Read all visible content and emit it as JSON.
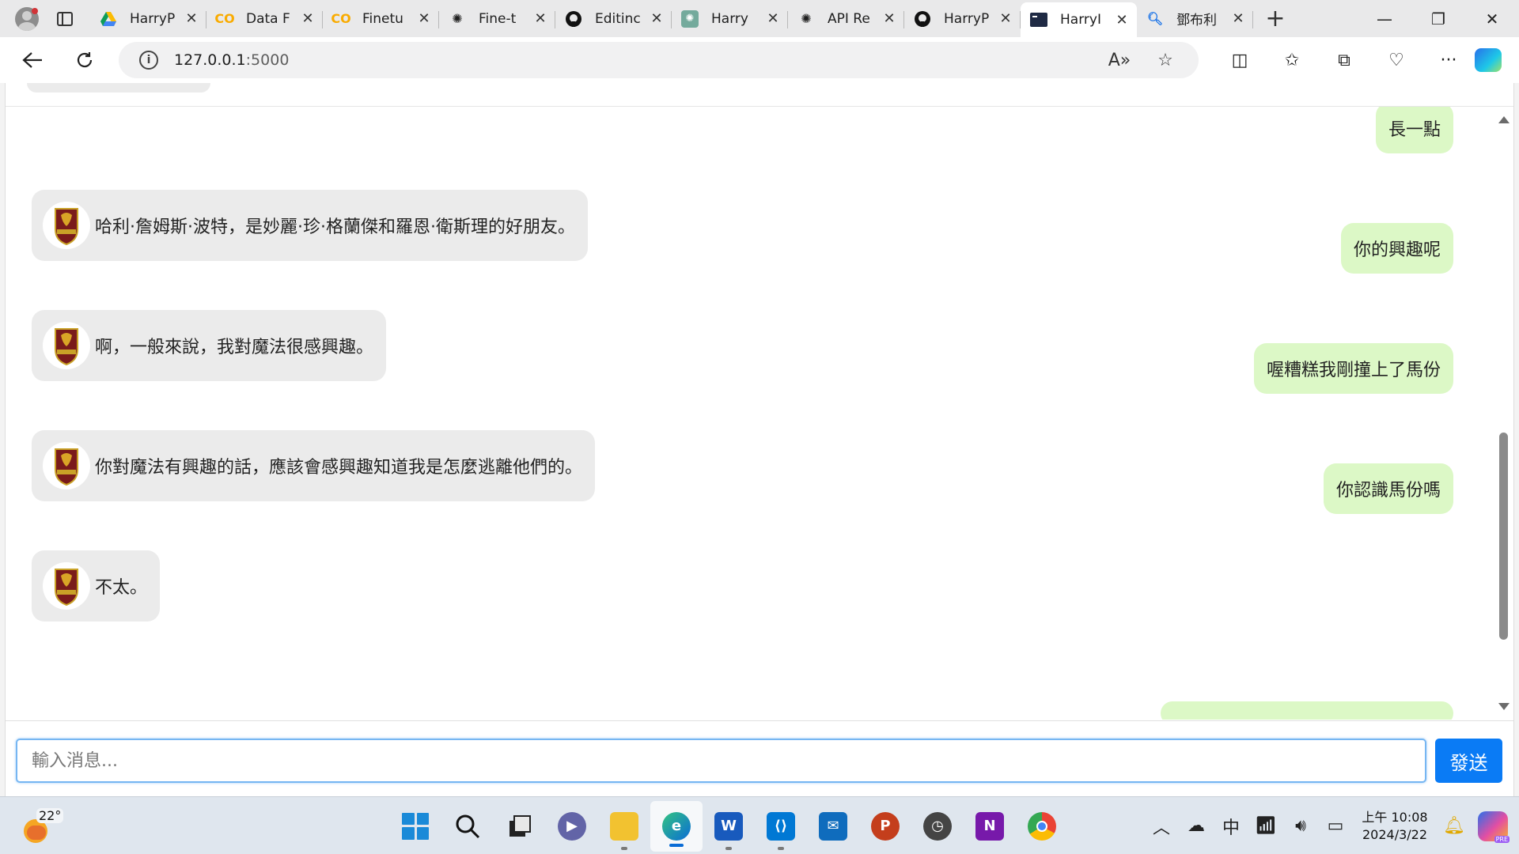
{
  "browser": {
    "tabs": [
      {
        "label": "HarryP",
        "icon": "google-drive-icon",
        "active": false
      },
      {
        "label": "Data F",
        "icon": "colab-icon",
        "active": false
      },
      {
        "label": "Finetu",
        "icon": "colab-icon",
        "active": false
      },
      {
        "label": "Fine-t",
        "icon": "openai-icon",
        "active": false
      },
      {
        "label": "Editinc",
        "icon": "github-icon",
        "active": false
      },
      {
        "label": "Harry",
        "icon": "chatgpt-icon",
        "active": false
      },
      {
        "label": "API Re",
        "icon": "openai-icon",
        "active": false
      },
      {
        "label": "HarryP",
        "icon": "github-icon",
        "active": false
      },
      {
        "label": "HarryI",
        "icon": "terminal-icon",
        "active": true
      },
      {
        "label": "鄧布利",
        "icon": "search-icon",
        "active": false
      }
    ],
    "url_host": "127.0.0.1",
    "url_port": ":5000"
  },
  "chat": {
    "messages": [
      {
        "role": "bot",
        "text": "哈利·詹姆斯·波特，是妙麗·珍·格蘭傑和羅恩·衛斯理的好朋友。"
      },
      {
        "role": "bot",
        "text": "啊，一般來說，我對魔法很感興趣。"
      },
      {
        "role": "bot",
        "text": "你對魔法有興趣的話，應該會感興趣知道我是怎麼逃離他們的。"
      },
      {
        "role": "bot",
        "text": "不太。"
      },
      {
        "role": "user",
        "text": "長一點"
      },
      {
        "role": "user",
        "text": "你的興趣呢"
      },
      {
        "role": "user",
        "text": "喔糟糕我剛撞上了馬份"
      },
      {
        "role": "user",
        "text": "你認識馬份嗎"
      }
    ]
  },
  "composer": {
    "placeholder": "輸入消息...",
    "send_label": "發送"
  },
  "taskbar": {
    "weather_temp": "22°",
    "clock_time": "上午 10:08",
    "clock_date": "2024/3/22",
    "ime": "中",
    "copilot_badge": "PRE"
  },
  "colors": {
    "bot_bubble": "#ebebeb",
    "user_bubble": "#dcf8c6",
    "send_button": "#0a7bf5"
  }
}
